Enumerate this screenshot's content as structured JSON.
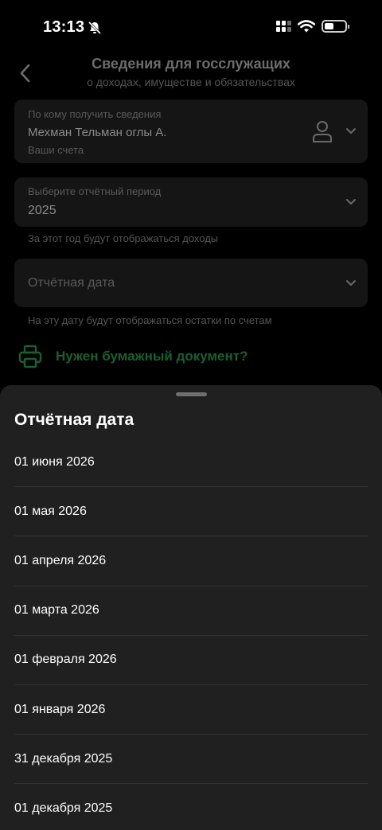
{
  "status_bar": {
    "time": "13:13",
    "battery_level": 0.45,
    "icons": [
      "bell-slash-icon",
      "cellular-signal-icon",
      "wifi-icon",
      "battery-icon"
    ]
  },
  "header": {
    "title": "Сведения для госслужащих",
    "subtitle": "о доходах, имуществе и обязательствах",
    "back_icon": "chevron-left-icon"
  },
  "recipient_field": {
    "label": "По кому получить сведения",
    "value": "Мехман Тельман оглы А.",
    "hint": "Ваши счета",
    "icon": "person-icon"
  },
  "period_field": {
    "label": "Выберите отчётный период",
    "value": "2025",
    "note": "За этот год будут отображаться доходы"
  },
  "report_date_field": {
    "placeholder": "Отчётная дата",
    "note": "На эту дату будут отображаться остатки по счетам"
  },
  "paper_document": {
    "label": "Нужен бумажный документ?",
    "icon": "printer-icon"
  },
  "sheet": {
    "title": "Отчётная дата",
    "options": [
      "01 июня 2026",
      "01 мая 2026",
      "01 апреля 2026",
      "01 марта 2026",
      "01 февраля 2026",
      "01 января 2026",
      "31 декабря 2025",
      "01 декабря 2025"
    ]
  },
  "colors": {
    "background": "#000000",
    "sheet": "#202020",
    "accent_green": "#1a5f2f",
    "text_primary": "#ffffff"
  }
}
